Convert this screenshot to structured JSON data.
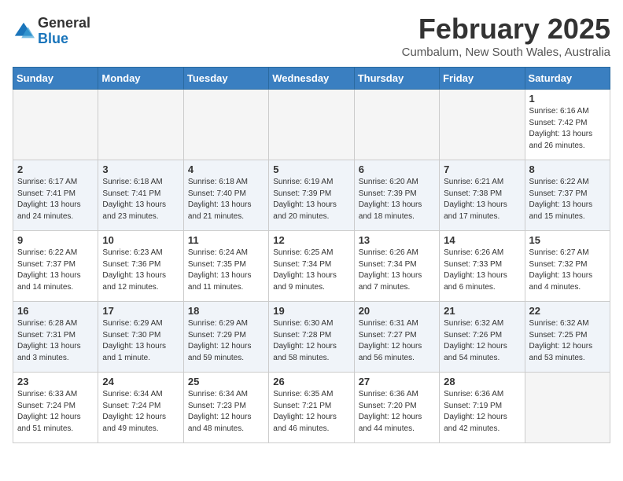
{
  "header": {
    "logo_general": "General",
    "logo_blue": "Blue",
    "month_year": "February 2025",
    "location": "Cumbalum, New South Wales, Australia"
  },
  "weekdays": [
    "Sunday",
    "Monday",
    "Tuesday",
    "Wednesday",
    "Thursday",
    "Friday",
    "Saturday"
  ],
  "weeks": [
    [
      {
        "day": "",
        "info": ""
      },
      {
        "day": "",
        "info": ""
      },
      {
        "day": "",
        "info": ""
      },
      {
        "day": "",
        "info": ""
      },
      {
        "day": "",
        "info": ""
      },
      {
        "day": "",
        "info": ""
      },
      {
        "day": "1",
        "info": "Sunrise: 6:16 AM\nSunset: 7:42 PM\nDaylight: 13 hours\nand 26 minutes."
      }
    ],
    [
      {
        "day": "2",
        "info": "Sunrise: 6:17 AM\nSunset: 7:41 PM\nDaylight: 13 hours\nand 24 minutes."
      },
      {
        "day": "3",
        "info": "Sunrise: 6:18 AM\nSunset: 7:41 PM\nDaylight: 13 hours\nand 23 minutes."
      },
      {
        "day": "4",
        "info": "Sunrise: 6:18 AM\nSunset: 7:40 PM\nDaylight: 13 hours\nand 21 minutes."
      },
      {
        "day": "5",
        "info": "Sunrise: 6:19 AM\nSunset: 7:39 PM\nDaylight: 13 hours\nand 20 minutes."
      },
      {
        "day": "6",
        "info": "Sunrise: 6:20 AM\nSunset: 7:39 PM\nDaylight: 13 hours\nand 18 minutes."
      },
      {
        "day": "7",
        "info": "Sunrise: 6:21 AM\nSunset: 7:38 PM\nDaylight: 13 hours\nand 17 minutes."
      },
      {
        "day": "8",
        "info": "Sunrise: 6:22 AM\nSunset: 7:37 PM\nDaylight: 13 hours\nand 15 minutes."
      }
    ],
    [
      {
        "day": "9",
        "info": "Sunrise: 6:22 AM\nSunset: 7:37 PM\nDaylight: 13 hours\nand 14 minutes."
      },
      {
        "day": "10",
        "info": "Sunrise: 6:23 AM\nSunset: 7:36 PM\nDaylight: 13 hours\nand 12 minutes."
      },
      {
        "day": "11",
        "info": "Sunrise: 6:24 AM\nSunset: 7:35 PM\nDaylight: 13 hours\nand 11 minutes."
      },
      {
        "day": "12",
        "info": "Sunrise: 6:25 AM\nSunset: 7:34 PM\nDaylight: 13 hours\nand 9 minutes."
      },
      {
        "day": "13",
        "info": "Sunrise: 6:26 AM\nSunset: 7:34 PM\nDaylight: 13 hours\nand 7 minutes."
      },
      {
        "day": "14",
        "info": "Sunrise: 6:26 AM\nSunset: 7:33 PM\nDaylight: 13 hours\nand 6 minutes."
      },
      {
        "day": "15",
        "info": "Sunrise: 6:27 AM\nSunset: 7:32 PM\nDaylight: 13 hours\nand 4 minutes."
      }
    ],
    [
      {
        "day": "16",
        "info": "Sunrise: 6:28 AM\nSunset: 7:31 PM\nDaylight: 13 hours\nand 3 minutes."
      },
      {
        "day": "17",
        "info": "Sunrise: 6:29 AM\nSunset: 7:30 PM\nDaylight: 13 hours\nand 1 minute."
      },
      {
        "day": "18",
        "info": "Sunrise: 6:29 AM\nSunset: 7:29 PM\nDaylight: 12 hours\nand 59 minutes."
      },
      {
        "day": "19",
        "info": "Sunrise: 6:30 AM\nSunset: 7:28 PM\nDaylight: 12 hours\nand 58 minutes."
      },
      {
        "day": "20",
        "info": "Sunrise: 6:31 AM\nSunset: 7:27 PM\nDaylight: 12 hours\nand 56 minutes."
      },
      {
        "day": "21",
        "info": "Sunrise: 6:32 AM\nSunset: 7:26 PM\nDaylight: 12 hours\nand 54 minutes."
      },
      {
        "day": "22",
        "info": "Sunrise: 6:32 AM\nSunset: 7:25 PM\nDaylight: 12 hours\nand 53 minutes."
      }
    ],
    [
      {
        "day": "23",
        "info": "Sunrise: 6:33 AM\nSunset: 7:24 PM\nDaylight: 12 hours\nand 51 minutes."
      },
      {
        "day": "24",
        "info": "Sunrise: 6:34 AM\nSunset: 7:24 PM\nDaylight: 12 hours\nand 49 minutes."
      },
      {
        "day": "25",
        "info": "Sunrise: 6:34 AM\nSunset: 7:23 PM\nDaylight: 12 hours\nand 48 minutes."
      },
      {
        "day": "26",
        "info": "Sunrise: 6:35 AM\nSunset: 7:21 PM\nDaylight: 12 hours\nand 46 minutes."
      },
      {
        "day": "27",
        "info": "Sunrise: 6:36 AM\nSunset: 7:20 PM\nDaylight: 12 hours\nand 44 minutes."
      },
      {
        "day": "28",
        "info": "Sunrise: 6:36 AM\nSunset: 7:19 PM\nDaylight: 12 hours\nand 42 minutes."
      },
      {
        "day": "",
        "info": ""
      }
    ]
  ]
}
